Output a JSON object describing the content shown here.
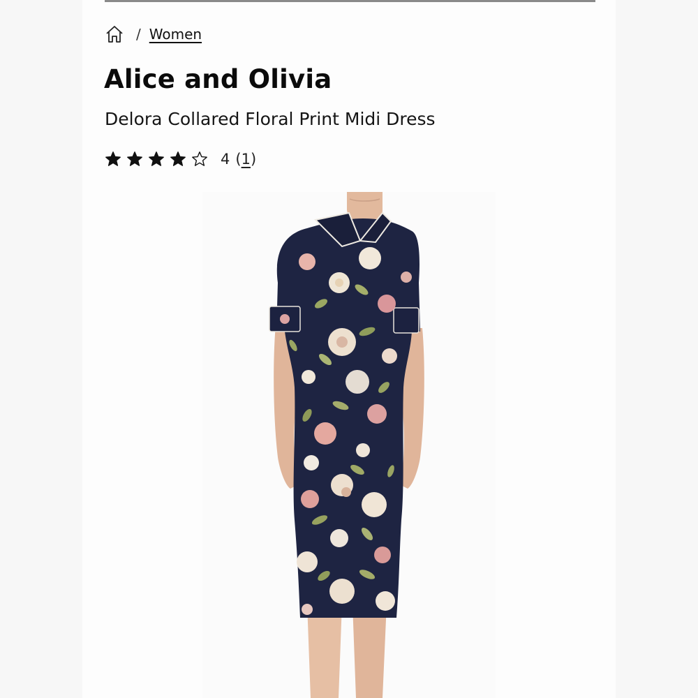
{
  "breadcrumb": {
    "home_icon": "home-icon",
    "separator": "/",
    "category": "Women"
  },
  "product": {
    "brand": "Alice and Olivia",
    "name": "Delora Collared Floral Print Midi Dress",
    "rating": {
      "value": "4",
      "max": 5,
      "filled_stars": 4,
      "review_count": "1",
      "open_paren": "(",
      "close_paren": ")"
    }
  },
  "colors": {
    "dress_navy": "#1e2442",
    "rose": "#d9969a",
    "cream": "#efe6d6",
    "leaf": "#9aa762"
  }
}
